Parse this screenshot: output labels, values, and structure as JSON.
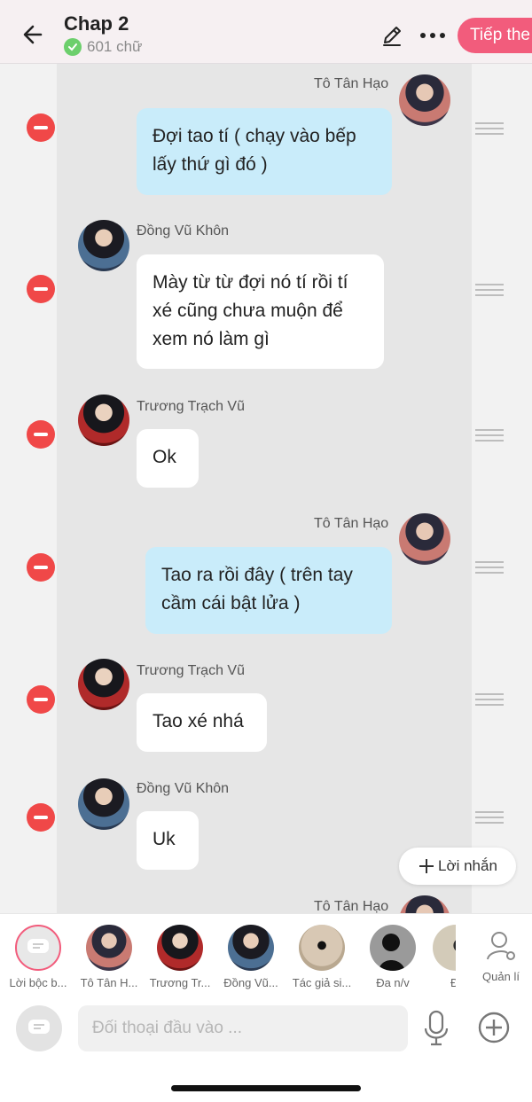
{
  "header": {
    "title": "Chap 2",
    "word_count": "601 chữ",
    "continue_label": "Tiếp the"
  },
  "messages": [
    {
      "speaker": "Tô Tân Hạo",
      "side": "right",
      "text": "Đợi tao tí ( chạy vào bếp lấy thứ gì đó )"
    },
    {
      "speaker": "Đồng Vũ Khôn",
      "side": "left",
      "text": "Mày từ từ đợi nó tí rồi tí xé cũng chưa muộn để xem nó làm gì"
    },
    {
      "speaker": "Trương Trạch Vũ",
      "side": "left",
      "text": "Ok"
    },
    {
      "speaker": "Tô Tân Hạo",
      "side": "right",
      "text": "Tao ra rồi đây ( trên tay cầm cái bật lửa )"
    },
    {
      "speaker": "Trương Trạch Vũ",
      "side": "left",
      "text": "Tao xé nhá"
    },
    {
      "speaker": "Đồng Vũ Khôn",
      "side": "left",
      "text": "Uk"
    },
    {
      "speaker": "Tô Tân Hạo",
      "side": "right",
      "text": ""
    }
  ],
  "add_note_label": "Lời nhắn",
  "characters": [
    {
      "label": "Lời bộc b...",
      "icon": "narration-icon"
    },
    {
      "label": "Tô Tân H..."
    },
    {
      "label": "Trương Tr..."
    },
    {
      "label": "Đồng Vũ..."
    },
    {
      "label": "Tác giả si..."
    },
    {
      "label": "Đa n/v"
    },
    {
      "label": "Đ"
    }
  ],
  "manage_label": "Quản lí",
  "input": {
    "placeholder": "Đối thoại đầu vào ..."
  },
  "colors": {
    "accent": "#f25c7c",
    "delete": "#f04848",
    "mine_bubble": "#c9ecfa",
    "other_bubble": "#ffffff"
  }
}
